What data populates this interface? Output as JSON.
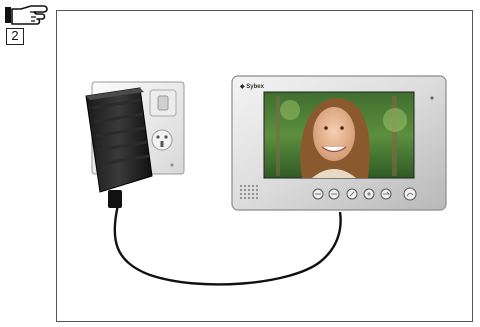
{
  "page": {
    "step_number": "2"
  },
  "illustration": {
    "monitor_brand": "◆ Sybex",
    "icons": {
      "pointer": "hand-pointing-icon",
      "adapter": "power-adapter-icon",
      "socket": "wall-socket-icon",
      "monitor": "video-door-phone-monitor-icon"
    }
  }
}
